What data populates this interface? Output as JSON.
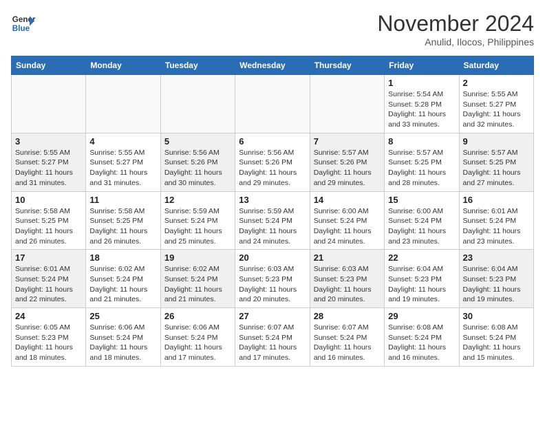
{
  "header": {
    "logo_line1": "General",
    "logo_line2": "Blue",
    "month": "November 2024",
    "location": "Anulid, Ilocos, Philippines"
  },
  "days_of_week": [
    "Sunday",
    "Monday",
    "Tuesday",
    "Wednesday",
    "Thursday",
    "Friday",
    "Saturday"
  ],
  "weeks": [
    [
      {
        "day": "",
        "info": ""
      },
      {
        "day": "",
        "info": ""
      },
      {
        "day": "",
        "info": ""
      },
      {
        "day": "",
        "info": ""
      },
      {
        "day": "",
        "info": ""
      },
      {
        "day": "1",
        "info": "Sunrise: 5:54 AM\nSunset: 5:28 PM\nDaylight: 11 hours and 33 minutes."
      },
      {
        "day": "2",
        "info": "Sunrise: 5:55 AM\nSunset: 5:27 PM\nDaylight: 11 hours and 32 minutes."
      }
    ],
    [
      {
        "day": "3",
        "info": "Sunrise: 5:55 AM\nSunset: 5:27 PM\nDaylight: 11 hours and 31 minutes."
      },
      {
        "day": "4",
        "info": "Sunrise: 5:55 AM\nSunset: 5:27 PM\nDaylight: 11 hours and 31 minutes."
      },
      {
        "day": "5",
        "info": "Sunrise: 5:56 AM\nSunset: 5:26 PM\nDaylight: 11 hours and 30 minutes."
      },
      {
        "day": "6",
        "info": "Sunrise: 5:56 AM\nSunset: 5:26 PM\nDaylight: 11 hours and 29 minutes."
      },
      {
        "day": "7",
        "info": "Sunrise: 5:57 AM\nSunset: 5:26 PM\nDaylight: 11 hours and 29 minutes."
      },
      {
        "day": "8",
        "info": "Sunrise: 5:57 AM\nSunset: 5:25 PM\nDaylight: 11 hours and 28 minutes."
      },
      {
        "day": "9",
        "info": "Sunrise: 5:57 AM\nSunset: 5:25 PM\nDaylight: 11 hours and 27 minutes."
      }
    ],
    [
      {
        "day": "10",
        "info": "Sunrise: 5:58 AM\nSunset: 5:25 PM\nDaylight: 11 hours and 26 minutes."
      },
      {
        "day": "11",
        "info": "Sunrise: 5:58 AM\nSunset: 5:25 PM\nDaylight: 11 hours and 26 minutes."
      },
      {
        "day": "12",
        "info": "Sunrise: 5:59 AM\nSunset: 5:24 PM\nDaylight: 11 hours and 25 minutes."
      },
      {
        "day": "13",
        "info": "Sunrise: 5:59 AM\nSunset: 5:24 PM\nDaylight: 11 hours and 24 minutes."
      },
      {
        "day": "14",
        "info": "Sunrise: 6:00 AM\nSunset: 5:24 PM\nDaylight: 11 hours and 24 minutes."
      },
      {
        "day": "15",
        "info": "Sunrise: 6:00 AM\nSunset: 5:24 PM\nDaylight: 11 hours and 23 minutes."
      },
      {
        "day": "16",
        "info": "Sunrise: 6:01 AM\nSunset: 5:24 PM\nDaylight: 11 hours and 23 minutes."
      }
    ],
    [
      {
        "day": "17",
        "info": "Sunrise: 6:01 AM\nSunset: 5:24 PM\nDaylight: 11 hours and 22 minutes."
      },
      {
        "day": "18",
        "info": "Sunrise: 6:02 AM\nSunset: 5:24 PM\nDaylight: 11 hours and 21 minutes."
      },
      {
        "day": "19",
        "info": "Sunrise: 6:02 AM\nSunset: 5:24 PM\nDaylight: 11 hours and 21 minutes."
      },
      {
        "day": "20",
        "info": "Sunrise: 6:03 AM\nSunset: 5:23 PM\nDaylight: 11 hours and 20 minutes."
      },
      {
        "day": "21",
        "info": "Sunrise: 6:03 AM\nSunset: 5:23 PM\nDaylight: 11 hours and 20 minutes."
      },
      {
        "day": "22",
        "info": "Sunrise: 6:04 AM\nSunset: 5:23 PM\nDaylight: 11 hours and 19 minutes."
      },
      {
        "day": "23",
        "info": "Sunrise: 6:04 AM\nSunset: 5:23 PM\nDaylight: 11 hours and 19 minutes."
      }
    ],
    [
      {
        "day": "24",
        "info": "Sunrise: 6:05 AM\nSunset: 5:23 PM\nDaylight: 11 hours and 18 minutes."
      },
      {
        "day": "25",
        "info": "Sunrise: 6:06 AM\nSunset: 5:24 PM\nDaylight: 11 hours and 18 minutes."
      },
      {
        "day": "26",
        "info": "Sunrise: 6:06 AM\nSunset: 5:24 PM\nDaylight: 11 hours and 17 minutes."
      },
      {
        "day": "27",
        "info": "Sunrise: 6:07 AM\nSunset: 5:24 PM\nDaylight: 11 hours and 17 minutes."
      },
      {
        "day": "28",
        "info": "Sunrise: 6:07 AM\nSunset: 5:24 PM\nDaylight: 11 hours and 16 minutes."
      },
      {
        "day": "29",
        "info": "Sunrise: 6:08 AM\nSunset: 5:24 PM\nDaylight: 11 hours and 16 minutes."
      },
      {
        "day": "30",
        "info": "Sunrise: 6:08 AM\nSunset: 5:24 PM\nDaylight: 11 hours and 15 minutes."
      }
    ]
  ]
}
